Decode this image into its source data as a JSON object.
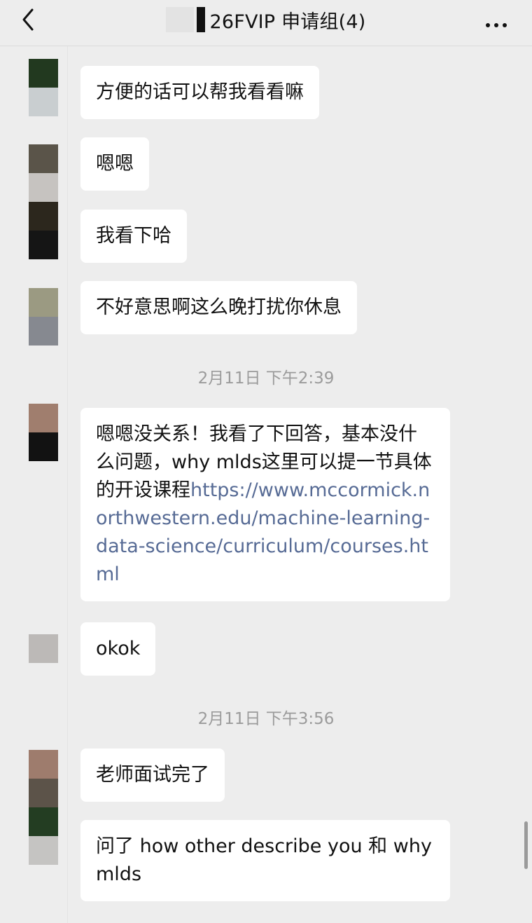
{
  "header": {
    "title": "26FVIP 申请组(4)",
    "back_icon": "chevron-left-icon",
    "more_icon": "more-dots-icon"
  },
  "messages": [
    {
      "text": "方便的话可以帮我看看嘛"
    },
    {
      "text": "嗯嗯"
    },
    {
      "text": "我看下哈"
    },
    {
      "text": "不好意思啊这么晚打扰你休息"
    },
    {
      "text": "嗯嗯没关系！我看了下回答，基本没什么问题，why mlds这里可以提一节具体的开设课程",
      "link": "https://www.mccormick.northwestern.edu/machine-learning-data-science/curriculum/courses.html"
    },
    {
      "text": "okok"
    },
    {
      "text": "老师面试完了"
    },
    {
      "text": "问了 how other describe you 和 why mlds"
    }
  ],
  "timestamps": [
    "2月11日 下午2:39",
    "2月11日 下午3:56"
  ],
  "colors": {
    "background": "#ededed",
    "bubble": "#ffffff",
    "link": "#576b95",
    "timestamp": "#9b9b9b"
  }
}
